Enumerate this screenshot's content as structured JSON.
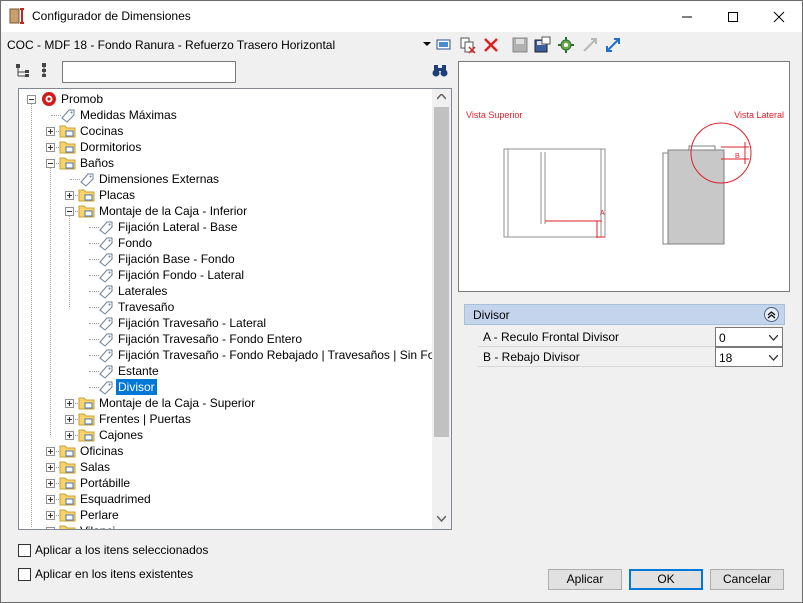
{
  "window": {
    "title": "Configurador de Dimensiones"
  },
  "toolbar": {
    "config_name": "COC - MDF 18 - Fondo Ranura - Refuerzo Trasero Horizontal"
  },
  "tree": {
    "items": [
      {
        "label": "Promob"
      },
      {
        "label": "Medidas Máximas"
      },
      {
        "label": "Cocinas"
      },
      {
        "label": "Dormitorios"
      },
      {
        "label": "Baños"
      },
      {
        "label": "Dimensiones Externas"
      },
      {
        "label": "Placas"
      },
      {
        "label": "Montaje de la Caja - Inferior"
      },
      {
        "label": "Fijación Lateral - Base"
      },
      {
        "label": "Fondo"
      },
      {
        "label": " Fijación Base - Fondo"
      },
      {
        "label": "Fijación Fondo - Lateral"
      },
      {
        "label": "Laterales"
      },
      {
        "label": "Travesaño"
      },
      {
        "label": "Fijación Travesaño - Lateral"
      },
      {
        "label": "Fijación Travesaño - Fondo Entero"
      },
      {
        "label": "Fijación Travesaño - Fondo Rebajado | Travesaños | Sin Fondo"
      },
      {
        "label": "Estante"
      },
      {
        "label": "Divisor"
      },
      {
        "label": "Montaje de la Caja - Superior"
      },
      {
        "label": "Frentes | Puertas"
      },
      {
        "label": "Cajones"
      },
      {
        "label": "Oficinas"
      },
      {
        "label": "Salas"
      },
      {
        "label": "Portábille"
      },
      {
        "label": "Esquadrimed"
      },
      {
        "label": "Perlare"
      },
      {
        "label": "Vilanci..."
      }
    ]
  },
  "preview": {
    "view_top_label": "Vista Superior",
    "view_side_label": "Vista Lateral",
    "marker_a": "A",
    "marker_b": "B"
  },
  "properties": {
    "group": "Divisor",
    "rows": [
      {
        "name": "A - Reculo Frontal Divisor",
        "value": "0"
      },
      {
        "name": "B - Rebajo Divisor",
        "value": "18"
      }
    ]
  },
  "options": {
    "apply_selected": "Aplicar a los itens seleccionados",
    "apply_existing": "Aplicar en los itens existentes"
  },
  "buttons": {
    "apply": "Aplicar",
    "ok": "OK",
    "cancel": "Cancelar"
  },
  "colors": {
    "selection": "#0078d7",
    "header": "#c3d4ec",
    "annotation_red": "#e0202a"
  }
}
